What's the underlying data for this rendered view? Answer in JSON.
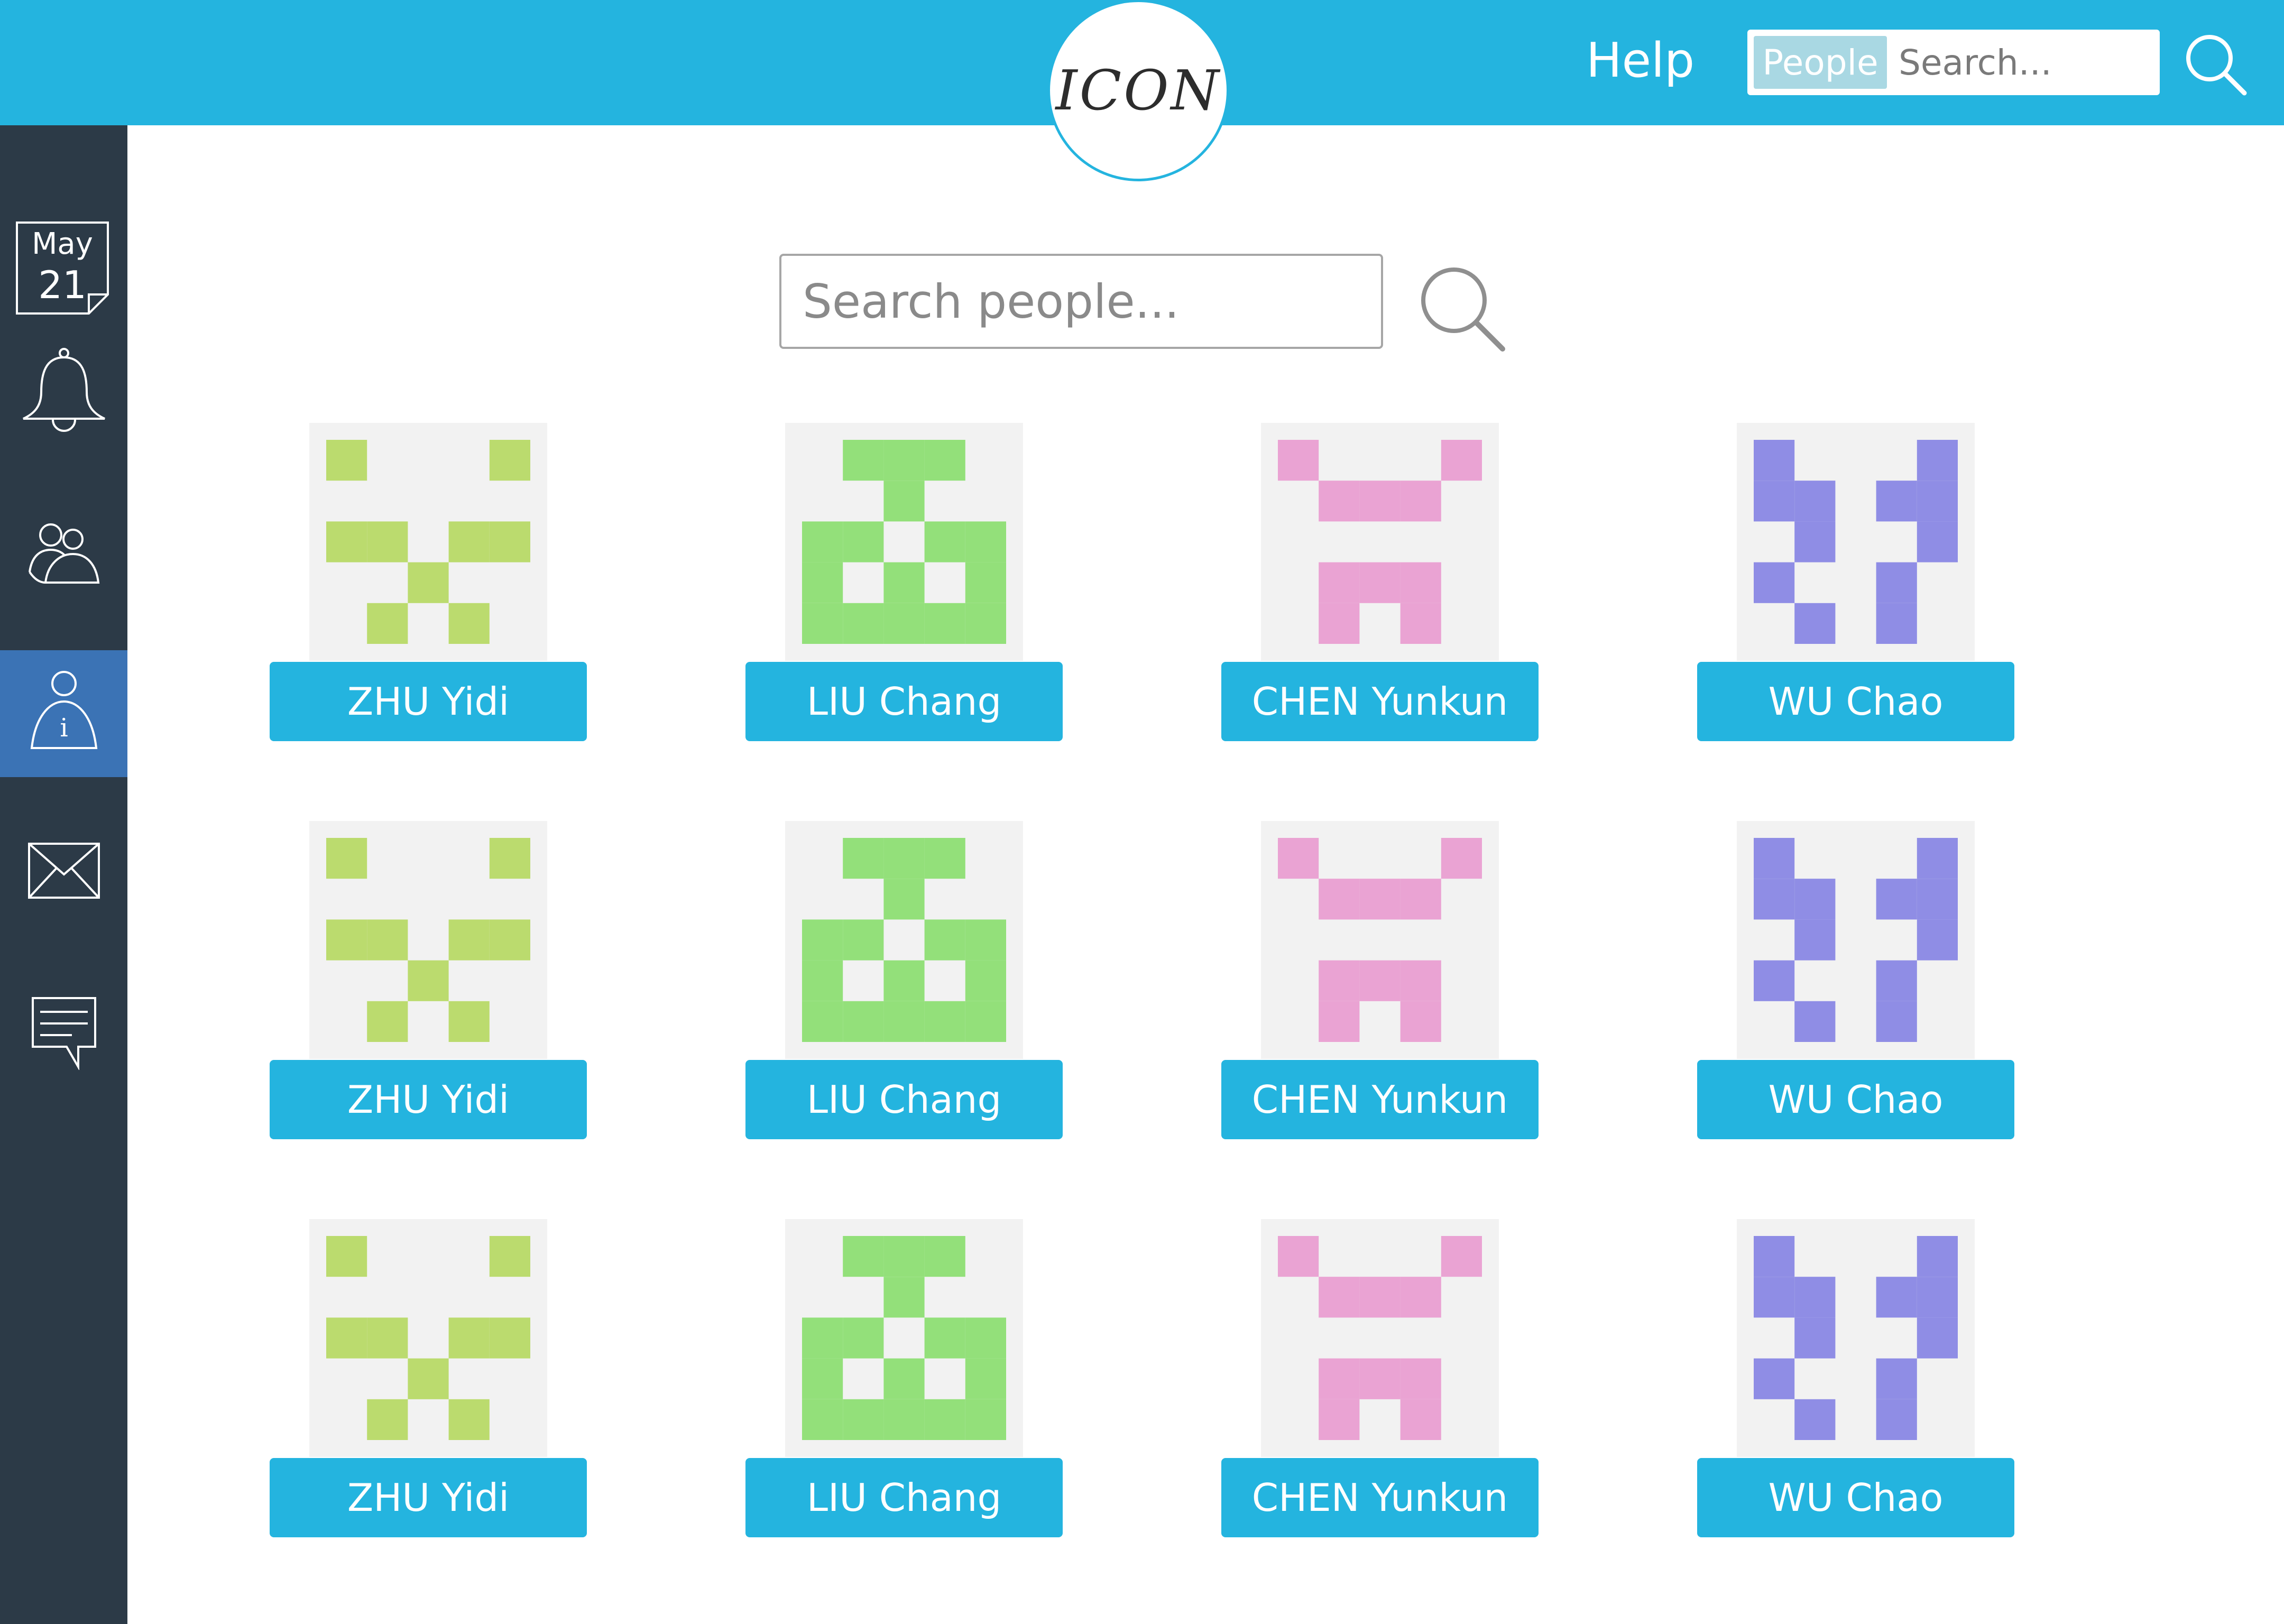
{
  "header": {
    "logo_text": "ICON",
    "help_label": "Help",
    "search_scope": "People",
    "search_placeholder": "Search...",
    "search_icon": "search-icon"
  },
  "sidebar": {
    "date": {
      "month": "May",
      "day": "21"
    },
    "items": [
      {
        "name": "calendar",
        "icon": "calendar-icon",
        "active": false
      },
      {
        "name": "notifications",
        "icon": "bell-icon",
        "active": false
      },
      {
        "name": "people",
        "icon": "people-icon",
        "active": false
      },
      {
        "name": "profile-info",
        "icon": "person-info-icon",
        "active": true
      },
      {
        "name": "mail",
        "icon": "envelope-icon",
        "active": false
      },
      {
        "name": "messages",
        "icon": "chat-icon",
        "active": false
      }
    ]
  },
  "main": {
    "search_placeholder": "Search people...",
    "search_icon": "search-icon"
  },
  "people": [
    {
      "name": "ZHU Yidi",
      "avatar": "zhu",
      "color": "#bbdb6e",
      "pattern": [
        "10001",
        "00000",
        "11011",
        "00100",
        "01010"
      ]
    },
    {
      "name": "LIU Chang",
      "avatar": "liu",
      "color": "#93e07a",
      "pattern": [
        "01110",
        "00100",
        "11011",
        "10101",
        "11111"
      ]
    },
    {
      "name": "CHEN Yunkun",
      "avatar": "chen",
      "color": "#eaa3d3",
      "pattern": [
        "10001",
        "01110",
        "00000",
        "01110",
        "01010"
      ]
    },
    {
      "name": "WU Chao",
      "avatar": "wu",
      "color": "#8f8de5",
      "pattern": [
        "10001",
        "11011",
        "01001",
        "10010",
        "01010"
      ]
    },
    {
      "name": "ZHU Yidi",
      "avatar": "zhu",
      "color": "#bbdb6e",
      "pattern": [
        "10001",
        "00000",
        "11011",
        "00100",
        "01010"
      ]
    },
    {
      "name": "LIU Chang",
      "avatar": "liu",
      "color": "#93e07a",
      "pattern": [
        "01110",
        "00100",
        "11011",
        "10101",
        "11111"
      ]
    },
    {
      "name": "CHEN Yunkun",
      "avatar": "chen",
      "color": "#eaa3d3",
      "pattern": [
        "10001",
        "01110",
        "00000",
        "01110",
        "01010"
      ]
    },
    {
      "name": "WU Chao",
      "avatar": "wu",
      "color": "#8f8de5",
      "pattern": [
        "10001",
        "11011",
        "01001",
        "10010",
        "01010"
      ]
    },
    {
      "name": "ZHU Yidi",
      "avatar": "zhu",
      "color": "#bbdb6e",
      "pattern": [
        "10001",
        "00000",
        "11011",
        "00100",
        "01010"
      ]
    },
    {
      "name": "LIU Chang",
      "avatar": "liu",
      "color": "#93e07a",
      "pattern": [
        "01110",
        "00100",
        "11011",
        "10101",
        "11111"
      ]
    },
    {
      "name": "CHEN Yunkun",
      "avatar": "chen",
      "color": "#eaa3d3",
      "pattern": [
        "10001",
        "01110",
        "00000",
        "01110",
        "01010"
      ]
    },
    {
      "name": "WU Chao",
      "avatar": "wu",
      "color": "#8f8de5",
      "pattern": [
        "10001",
        "11011",
        "01001",
        "10010",
        "01010"
      ]
    }
  ],
  "colors": {
    "accent": "#24b4df",
    "sidebar": "#2c3a47",
    "sidebar_active": "#3b73b5",
    "avatar_bg": "#f2f2f2"
  }
}
